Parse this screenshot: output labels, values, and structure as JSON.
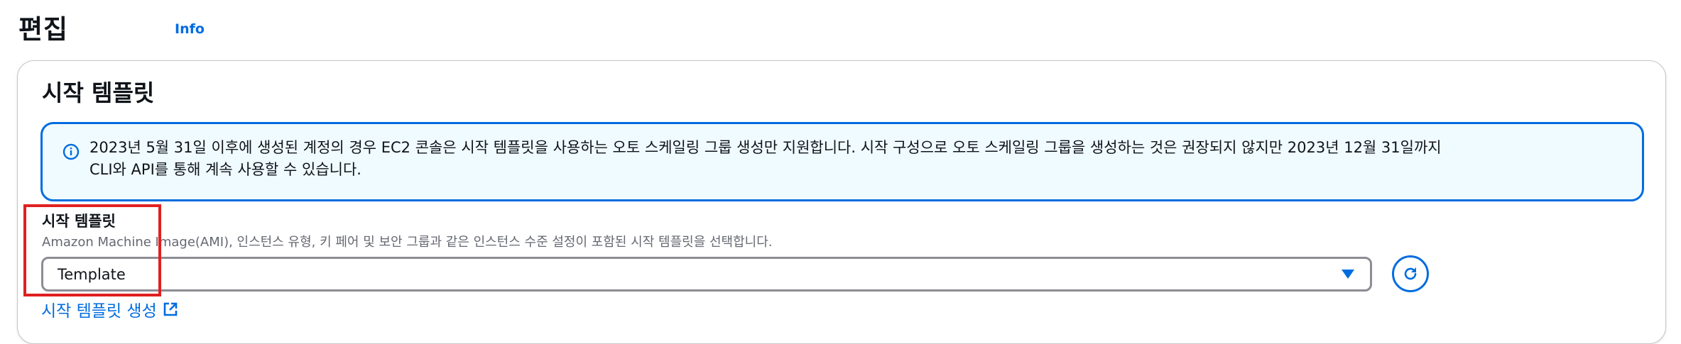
{
  "header": {
    "title": "편집",
    "info_label": "Info"
  },
  "section": {
    "title": "시작 템플릿"
  },
  "alert": {
    "icon": "info-icon",
    "line1": "2023년 5월 31일 이후에 생성된 계정의 경우 EC2 콘솔은 시작 템플릿을 사용하는 오토 스케일링 그룹 생성만 지원합니다. 시작 구성으로 오토 스케일링 그룹을 생성하는 것은 권장되지 않지만 2023년 12월 31일까지",
    "line2": "CLI와 API를 통해 계속 사용할 수 있습니다.",
    "accent_color": "#006ce0",
    "background_color": "#f0fbff"
  },
  "launch_template": {
    "label": "시작 템플릿",
    "description": "Amazon Machine Image(AMI), 인스턴스 유형, 키 페어 및 보안 그룹과 같은 인스턴스 수준 설정이 포함된 시작 템플릿을 선택합니다.",
    "selected_value": "Template",
    "create_link_label": "시작 템플릿 생성"
  },
  "colors": {
    "link": "#006ce0",
    "highlight": "#e02020",
    "border": "#c6c6cd"
  }
}
